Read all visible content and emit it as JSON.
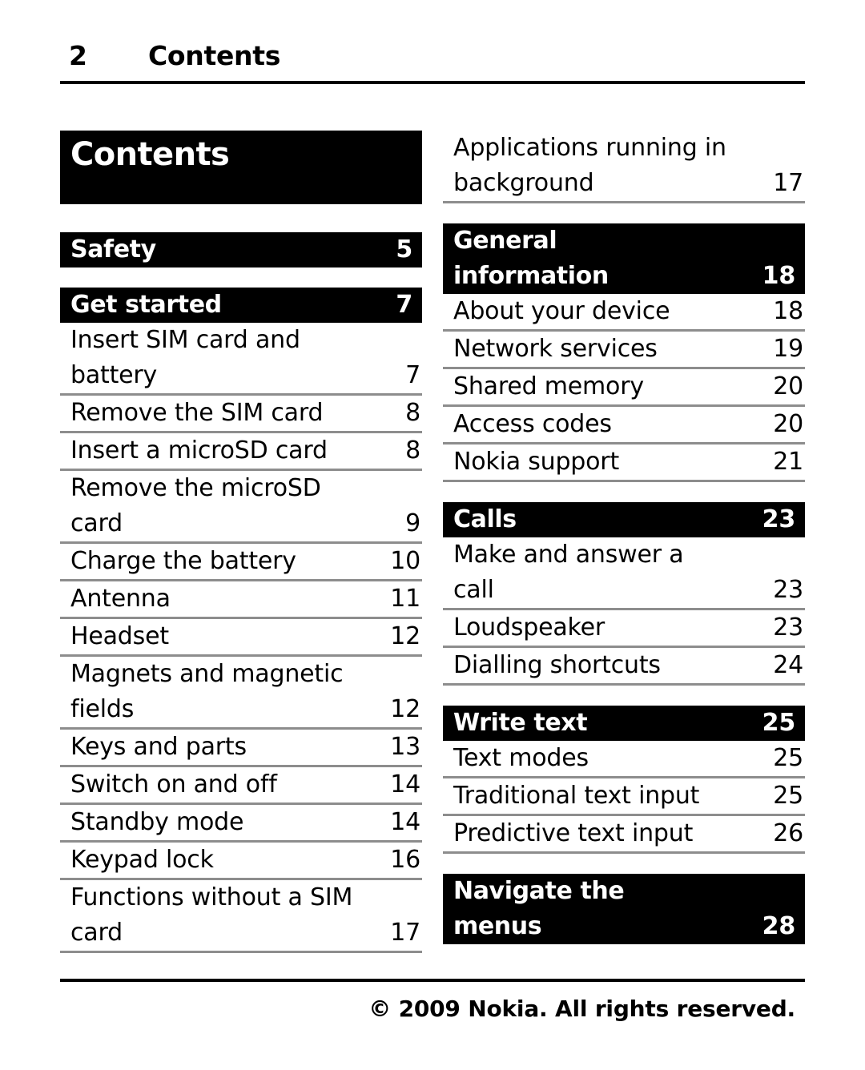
{
  "header": {
    "page_number": "2",
    "title": "Contents"
  },
  "title_block": {
    "label": "Contents"
  },
  "left_column": [
    {
      "type": "black",
      "label": "Safety",
      "page": "5",
      "gap_before": "md"
    },
    {
      "type": "black",
      "label": "Get started",
      "page": "7",
      "gap_before": "sm"
    },
    {
      "type": "plain",
      "label": "Insert SIM card and\nbattery",
      "page": "7"
    },
    {
      "type": "plain",
      "label": "Remove the SIM card",
      "page": "8"
    },
    {
      "type": "plain",
      "label": "Insert a microSD card",
      "page": "8"
    },
    {
      "type": "plain",
      "label": "Remove the microSD\ncard",
      "page": "9"
    },
    {
      "type": "plain",
      "label": "Charge the battery",
      "page": "10"
    },
    {
      "type": "plain",
      "label": "Antenna",
      "page": "11"
    },
    {
      "type": "plain",
      "label": "Headset",
      "page": "12"
    },
    {
      "type": "plain",
      "label": "Magnets and magnetic\nfields",
      "page": "12"
    },
    {
      "type": "plain",
      "label": "Keys and parts",
      "page": "13"
    },
    {
      "type": "plain",
      "label": "Switch on and off",
      "page": "14"
    },
    {
      "type": "plain",
      "label": "Standby mode",
      "page": "14"
    },
    {
      "type": "plain",
      "label": "Keypad lock",
      "page": "16"
    },
    {
      "type": "plain",
      "label": "Functions without a SIM\ncard",
      "page": "17"
    }
  ],
  "right_column": [
    {
      "type": "plain",
      "label": "Applications running in\nbackground",
      "page": "17"
    },
    {
      "type": "black",
      "label": "General\ninformation",
      "page": "18",
      "gap_before": "sm"
    },
    {
      "type": "plain",
      "label": "About your device",
      "page": "18"
    },
    {
      "type": "plain",
      "label": "Network services",
      "page": "19"
    },
    {
      "type": "plain",
      "label": "Shared memory",
      "page": "20"
    },
    {
      "type": "plain",
      "label": "Access codes",
      "page": "20"
    },
    {
      "type": "plain",
      "label": "Nokia support",
      "page": "21"
    },
    {
      "type": "black",
      "label": "Calls",
      "page": "23",
      "gap_before": "sm"
    },
    {
      "type": "plain",
      "label": "Make and answer a\ncall",
      "page": "23"
    },
    {
      "type": "plain",
      "label": "Loudspeaker",
      "page": "23"
    },
    {
      "type": "plain",
      "label": "Dialling shortcuts",
      "page": "24"
    },
    {
      "type": "black",
      "label": "Write text",
      "page": "25",
      "gap_before": "sm"
    },
    {
      "type": "plain",
      "label": "Text modes",
      "page": "25"
    },
    {
      "type": "plain",
      "label": "Traditional text input",
      "page": "25"
    },
    {
      "type": "plain",
      "label": "Predictive text input",
      "page": "26"
    },
    {
      "type": "black",
      "label": "Navigate the\nmenus",
      "page": "28",
      "gap_before": "sm"
    }
  ],
  "footer": {
    "copyright": "© 2009 Nokia. All rights reserved."
  }
}
